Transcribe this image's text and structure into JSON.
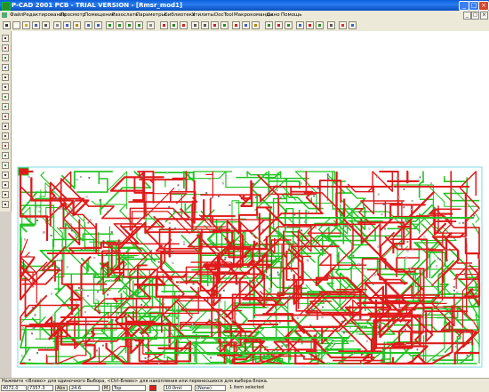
{
  "window": {
    "title": "P-CAD 2001 PCB - TRIAL VERSION - [Rmsr_mod1]",
    "minimize": "_",
    "maximize": "□",
    "close": "×"
  },
  "menu": {
    "items": [
      "Файл",
      "Редактирование",
      "Просмотр",
      "Помещение",
      "Разослать",
      "Параметры",
      "Библиотека",
      "Утилиты",
      "DocTool",
      "Макрокоманды",
      "Окно",
      "Помощь"
    ],
    "mdi_controls": [
      "_",
      "□",
      "×"
    ]
  },
  "toolbar": {
    "icons": [
      "pointer-icon",
      "new-icon",
      "open-icon",
      "save-icon",
      "print-icon",
      "cut-icon",
      "copy-icon",
      "paste-icon",
      "undo-icon",
      "redo-icon",
      "zoom-in-icon",
      "zoom-out-icon",
      "zoom-window-icon",
      "zoom-extent-icon",
      "redraw-icon",
      "route-icon",
      "select-net-icon",
      "layers-icon",
      "grid-icon",
      "measure-icon",
      "pad-icon",
      "via-icon",
      "drc-icon",
      "report-icon",
      "library-icon",
      "component-icon",
      "symbol-icon",
      "netlist-icon",
      "bus-icon",
      "copper-icon",
      "fill-icon",
      "text-icon",
      "stop-icon",
      "help-icon"
    ]
  },
  "left_toolbar": {
    "icons": [
      "place-part-icon",
      "place-pad-icon",
      "zoom-area-icon",
      "connection-icon",
      "line-icon",
      "arc-icon",
      "polygon-icon",
      "copper-pour-icon",
      "cutout-icon",
      "eraser-icon",
      "keepout-icon",
      "no-entry-icon",
      "dimension-icon",
      "point-icon",
      "text-tool-icon",
      "attribute-icon",
      "field-icon",
      "ruler-icon"
    ]
  },
  "status": {
    "message": "Нажмите <Влево> для одиночного Выбора, <Ctrl-Влево> для накопления или перенесшихся для выбора блока.",
    "x_coord": "4072.0",
    "y_coord": "7357.3",
    "abs_label": "Abs",
    "grid_value": "24.6",
    "mode_label": "M",
    "layer": "Top",
    "line_width": "10.0mil",
    "style": "(None)",
    "selection": "1 item selected"
  },
  "colors": {
    "board_outline": "#5fd0e0",
    "top_trace": "#e01a1a",
    "bottom_trace": "#22c322",
    "workspace": "#ffffff"
  }
}
